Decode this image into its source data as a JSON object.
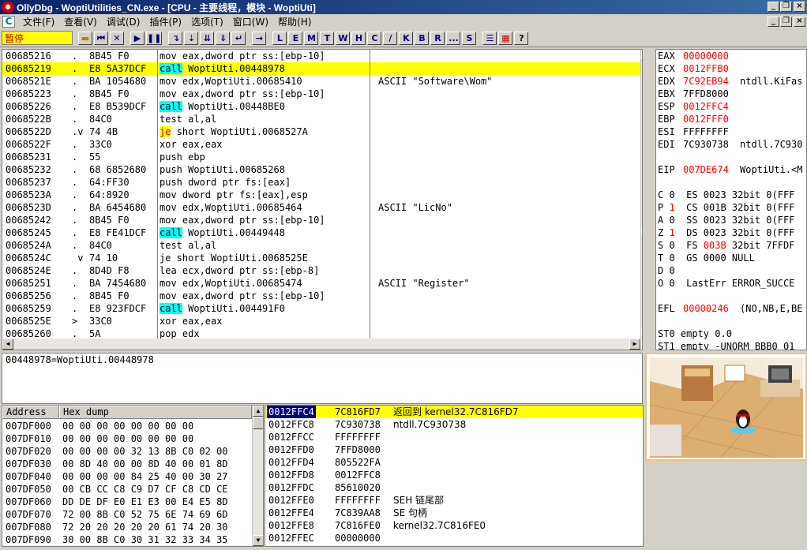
{
  "window": {
    "title": "OllyDbg - WoptiUtilities_CN.exe - [CPU - 主要线程，模块 - WoptiUti]"
  },
  "menu": [
    "文件(F)",
    "查看(V)",
    "调试(D)",
    "插件(P)",
    "选项(T)",
    "窗口(W)",
    "帮助(H)"
  ],
  "status": "暂停",
  "toolbar_letters": [
    "L",
    "E",
    "M",
    "T",
    "W",
    "H",
    "C",
    "/",
    "K",
    "B",
    "R",
    "...",
    "S"
  ],
  "disasm": [
    {
      "addr": "00685216",
      "mark": ".",
      "hex": "8B45 F0",
      "asm": "mov eax,dword ptr ss:[ebp-10]",
      "comment": ""
    },
    {
      "addr": "00685219",
      "mark": ".",
      "hex": "E8 5A37DCF",
      "asm_hl": "call",
      "asm_rest": " WoptiUti.00448978",
      "comment": "",
      "selected": true
    },
    {
      "addr": "0068521E",
      "mark": ".",
      "hex": "BA 1054680",
      "asm": "mov edx,WoptiUti.00685410",
      "comment": "ASCII \"Software\\Wom\""
    },
    {
      "addr": "00685223",
      "mark": ".",
      "hex": "8B45 F0",
      "asm": "mov eax,dword ptr ss:[ebp-10]",
      "comment": ""
    },
    {
      "addr": "00685226",
      "mark": ".",
      "hex": "E8 B539DCF",
      "asm_hl": "call",
      "asm_rest": " WoptiUti.00448BE0",
      "comment": ""
    },
    {
      "addr": "0068522B",
      "mark": ".",
      "hex": "84C0",
      "asm": "test al,al",
      "comment": ""
    },
    {
      "addr": "0068522D",
      "mark": ".v",
      "hex": "74 4B",
      "asm_jmp": "je",
      "asm_rest": " short WoptiUti.0068527A",
      "comment": ""
    },
    {
      "addr": "0068522F",
      "mark": ".",
      "hex": "33C0",
      "asm": "xor eax,eax",
      "comment": ""
    },
    {
      "addr": "00685231",
      "mark": ".",
      "hex": "55",
      "asm": "push ebp",
      "comment": ""
    },
    {
      "addr": "00685232",
      "mark": ".",
      "hex": "68 6852680",
      "asm": "push WoptiUti.00685268",
      "comment": ""
    },
    {
      "addr": "00685237",
      "mark": ".",
      "hex": "64:FF30",
      "asm": "push dword ptr fs:[eax]",
      "comment": ""
    },
    {
      "addr": "0068523A",
      "mark": ".",
      "hex": "64:8920",
      "asm": "mov dword ptr fs:[eax],esp",
      "comment": ""
    },
    {
      "addr": "0068523D",
      "mark": ".",
      "hex": "BA 6454680",
      "asm": "mov edx,WoptiUti.00685464",
      "comment": "ASCII \"LicNo\""
    },
    {
      "addr": "00685242",
      "mark": ".",
      "hex": "8B45 F0",
      "asm": "mov eax,dword ptr ss:[ebp-10]",
      "comment": ""
    },
    {
      "addr": "00685245",
      "mark": ".",
      "hex": "E8 FE41DCF",
      "asm_hl": "call",
      "asm_rest": " WoptiUti.00449448",
      "comment": ""
    },
    {
      "addr": "0068524A",
      "mark": ".",
      "hex": "84C0",
      "asm": "test al,al",
      "comment": ""
    },
    {
      "addr": "0068524C",
      "mark": " v",
      "hex": "74 10",
      "asm": "je short WoptiUti.0068525E",
      "comment": ""
    },
    {
      "addr": "0068524E",
      "mark": ".",
      "hex": "8D4D F8",
      "asm": "lea ecx,dword ptr ss:[ebp-8]",
      "comment": ""
    },
    {
      "addr": "00685251",
      "mark": ".",
      "hex": "BA 7454680",
      "asm": "mov edx,WoptiUti.00685474",
      "comment": "ASCII \"Register\""
    },
    {
      "addr": "00685256",
      "mark": ".",
      "hex": "8B45 F0",
      "asm": "mov eax,dword ptr ss:[ebp-10]",
      "comment": ""
    },
    {
      "addr": "00685259",
      "mark": ".",
      "hex": "E8 923FDCF",
      "asm_hl": "call",
      "asm_rest": " WoptiUti.004491F0",
      "comment": ""
    },
    {
      "addr": "0068525E",
      "mark": ">",
      "hex": "33C0",
      "asm": "xor eax,eax",
      "comment": ""
    },
    {
      "addr": "00685260",
      "mark": ".",
      "hex": "5A",
      "asm": "pop edx",
      "comment": ""
    }
  ],
  "registers": [
    {
      "name": "EAX",
      "val": "00000000",
      "red": true,
      "cmt": ""
    },
    {
      "name": "ECX",
      "val": "0012FFB0",
      "red": true,
      "cmt": ""
    },
    {
      "name": "EDX",
      "val": "7C92EB94",
      "red": true,
      "cmt": "ntdll.KiFas"
    },
    {
      "name": "EBX",
      "val": "7FFD8000",
      "red": false,
      "cmt": ""
    },
    {
      "name": "ESP",
      "val": "0012FFC4",
      "red": true,
      "cmt": ""
    },
    {
      "name": "EBP",
      "val": "0012FFF0",
      "red": true,
      "cmt": ""
    },
    {
      "name": "ESI",
      "val": "FFFFFFFF",
      "red": false,
      "cmt": ""
    },
    {
      "name": "EDI",
      "val": "7C930738",
      "red": false,
      "cmt": "ntdll.7C930"
    },
    {
      "name": "",
      "val": "",
      "red": false,
      "cmt": ""
    },
    {
      "name": "EIP",
      "val": "007DE674",
      "red": true,
      "cmt": "WoptiUti.<M"
    },
    {
      "name": "",
      "val": "",
      "red": false,
      "cmt": ""
    },
    {
      "text": "C 0  ES 0023 32bit 0(FFF"
    },
    {
      "text": "P 1  CS 001B 32bit 0(FFF",
      "redp": true
    },
    {
      "text": "A 0  SS 0023 32bit 0(FFF"
    },
    {
      "text": "Z 1  DS 0023 32bit 0(FFF",
      "redp": true
    },
    {
      "text": "S 0  FS 003B 32bit 7FFDF",
      "redfs": true
    },
    {
      "text": "T 0  GS 0000 NULL"
    },
    {
      "text": "D 0"
    },
    {
      "text": "O 0  LastErr ERROR_SUCCE"
    },
    {
      "name": "",
      "val": "",
      "red": false,
      "cmt": ""
    },
    {
      "name": "EFL",
      "val": "00000246",
      "red": true,
      "cmt": "(NO,NB,E,BE"
    },
    {
      "name": "",
      "val": "",
      "red": false,
      "cmt": ""
    },
    {
      "text": "ST0 empty 0.0"
    },
    {
      "text": "ST1 empty -UNORM BBB0 01"
    },
    {
      "text": "ST2 empty 0.0"
    },
    {
      "text": "ST3 empty 0.0"
    }
  ],
  "info_line": "00448978=WoptiUti.00448978",
  "dump": {
    "header_address": "Address",
    "header_hex": "Hex dump",
    "rows": [
      {
        "addr": "007DF000",
        "hex": "00 00 00 00 00 00 00 00"
      },
      {
        "addr": "007DF010",
        "hex": "00 00 00 00 00 00 00 00"
      },
      {
        "addr": "007DF020",
        "hex": "00 00 00 00 32 13 8B C0 02 00"
      },
      {
        "addr": "007DF030",
        "hex": "00 8D 40 00 00 8D 40 00 01 8D"
      },
      {
        "addr": "007DF040",
        "hex": "00 00 00 00 84 25 40 00 30 27"
      },
      {
        "addr": "007DF050",
        "hex": "00 CB CC C8 C9 D7 CF C8 CD CE"
      },
      {
        "addr": "007DF060",
        "hex": "DD DE DF E0 E1 E3 00 E4 E5 8D"
      },
      {
        "addr": "007DF070",
        "hex": "72 00 8B C0 52 75 6E 74 69 6D"
      },
      {
        "addr": "007DF080",
        "hex": "72 20 20 20 20 20 61 74 20 30"
      },
      {
        "addr": "007DF090",
        "hex": "30 00 8B C0 30 31 32 33 34 35"
      }
    ]
  },
  "stack": [
    {
      "addr": "0012FFC4",
      "val": "7C816FD7",
      "cmt": "返回到 kernel32.7C816FD7",
      "selected": true
    },
    {
      "addr": "0012FFC8",
      "val": "7C930738",
      "cmt": "ntdll.7C930738"
    },
    {
      "addr": "0012FFCC",
      "val": "FFFFFFFF",
      "cmt": ""
    },
    {
      "addr": "0012FFD0",
      "val": "7FFD8000",
      "cmt": ""
    },
    {
      "addr": "0012FFD4",
      "val": "805522FA",
      "cmt": ""
    },
    {
      "addr": "0012FFD8",
      "val": "0012FFC8",
      "cmt": ""
    },
    {
      "addr": "0012FFDC",
      "val": "85610020",
      "cmt": ""
    },
    {
      "addr": "0012FFE0",
      "val": "FFFFFFFF",
      "cmt": "SEH 链尾部"
    },
    {
      "addr": "0012FFE4",
      "val": "7C839AA8",
      "cmt": "SE 句柄"
    },
    {
      "addr": "0012FFE8",
      "val": "7C816FE0",
      "cmt": "kernel32.7C816FE0"
    },
    {
      "addr": "0012FFEC",
      "val": "00000000",
      "cmt": ""
    }
  ]
}
